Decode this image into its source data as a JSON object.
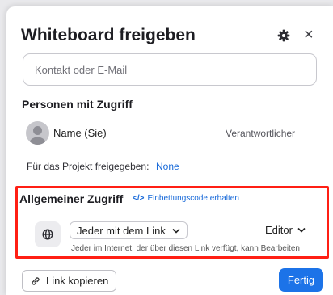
{
  "dialog": {
    "title": "Whiteboard freigeben",
    "close_symbol": "×",
    "icons": {
      "settings": "gear-icon",
      "close": "close-icon"
    }
  },
  "contact": {
    "placeholder": "Kontakt oder E-Mail",
    "value": ""
  },
  "people": {
    "section_title": "Personen mit Zugriff",
    "person": {
      "name": "Name (Sie)",
      "role": "Verantwortlicher"
    },
    "project_label": "Für das Projekt freigegeben:",
    "project_value": "None"
  },
  "general_access": {
    "title": "Allgemeiner Zugriff",
    "embed_icon_text": "</>",
    "embed_link": "Einbettungscode erhalten",
    "access_option": "Jeder mit dem Link",
    "role_option": "Editor",
    "description": "Jeder im Internet, der über diesen Link verfügt, kann Bearbeiten"
  },
  "footer": {
    "copy_label": "Link kopieren",
    "done_label": "Fertig"
  },
  "colors": {
    "accent": "#1c73e8",
    "link": "#1769d9",
    "highlight": "#ff1f14"
  }
}
